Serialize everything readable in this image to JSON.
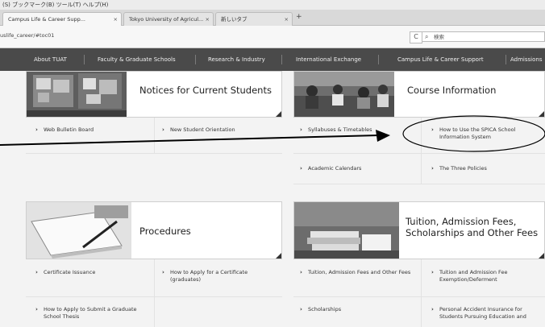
{
  "menubar": {
    "text": "(S)  ブックマーク(B)  ツール(T)  ヘルプ(H)"
  },
  "tabs": [
    {
      "label": "Campus Life & Career Supp...",
      "active": true
    },
    {
      "label": "Tokyo University of Agricul...",
      "active": false
    },
    {
      "label": "新しいタブ",
      "active": false
    }
  ],
  "toolbar": {
    "new_tab": "+",
    "url": "uslife_career/#toc01",
    "reload": "C",
    "search_placeholder": "検索"
  },
  "nav": {
    "items": [
      "About TUAT",
      "Faculty & Graduate Schools",
      "Research & Industry",
      "International Exchange",
      "Campus Life & Career Support",
      "Admissions"
    ]
  },
  "sections": [
    {
      "title": "Notices for Current Students",
      "links": [
        "Web Bulletin Board",
        "New Student Orientation"
      ]
    },
    {
      "title": "Course Information",
      "links": [
        "Syllabuses & Timetables",
        "How to Use the SPICA School Information System",
        "Academic Calendars",
        "The Three Policies"
      ]
    },
    {
      "title": "Procedures",
      "links": [
        "Certificate Issuance",
        "How to Apply for a Certificate (graduates)",
        "How to Apply to Submit a Graduate School Thesis"
      ]
    },
    {
      "title": "Tuition, Admission Fees, Scholarships and Other Fees",
      "links": [
        "Tuition, Admission Fees and Other Fees",
        "Tuition and Admission Fee Exemption/Deferment",
        "Scholarships",
        "Personal Accident Insurance for Students Pursuing Education and"
      ]
    }
  ],
  "colors": {
    "nav_bg": "#4a4a4a",
    "page_bg": "#f3f3f3",
    "annotation": "#000000"
  }
}
